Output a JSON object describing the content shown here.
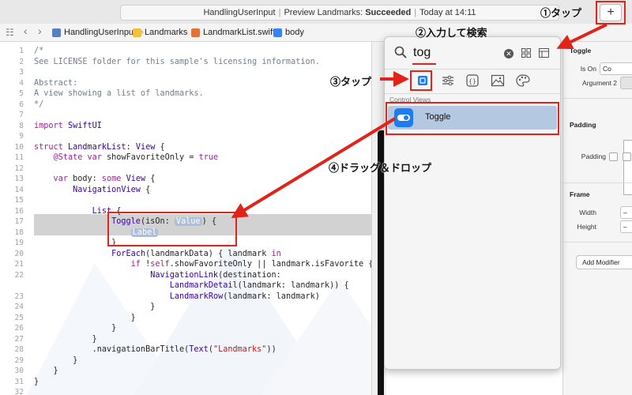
{
  "titlebar": {
    "project": "HandlingUserInput",
    "preview_label": "Preview Landmarks:",
    "status": "Succeeded",
    "time": "Today at 14:11",
    "add_button": "+"
  },
  "breadcrumb": [
    "HandlingUserInput",
    "Landmarks",
    "LandmarkList.swift",
    "body"
  ],
  "code": {
    "lines": [
      {
        "n": "1",
        "text": "/*"
      },
      {
        "n": "2",
        "text": "See LICENSE folder for this sample's licensing information."
      },
      {
        "n": "3",
        "text": ""
      },
      {
        "n": "4",
        "text": "Abstract:"
      },
      {
        "n": "5",
        "text": "A view showing a list of landmarks."
      },
      {
        "n": "6",
        "text": "*/"
      },
      {
        "n": "7",
        "text": ""
      },
      {
        "n": "8",
        "text": "import SwiftUI"
      },
      {
        "n": "9",
        "text": ""
      },
      {
        "n": "10",
        "text": "struct LandmarkList: View {"
      },
      {
        "n": "11",
        "text": "    @State var showFavoriteOnly = true"
      },
      {
        "n": "12",
        "text": ""
      },
      {
        "n": "13",
        "text": "    var body: some View {"
      },
      {
        "n": "14",
        "text": "        NavigationView {"
      },
      {
        "n": "15",
        "text": ""
      },
      {
        "n": "16",
        "text": "            List {"
      },
      {
        "n": "17",
        "text": "                Toggle(isOn: Value) {"
      },
      {
        "n": "18",
        "text": "                    Label"
      },
      {
        "n": "19",
        "text": "                }"
      },
      {
        "n": "20",
        "text": "                ForEach(landmarkData) { landmark in"
      },
      {
        "n": "21",
        "text": "                    if !self.showFavoriteOnly || landmark.isFavorite {"
      },
      {
        "n": "22",
        "text": "                        NavigationLink(destination:"
      },
      {
        "n": "",
        "text": "                            LandmarkDetail(landmark: landmark)) {"
      },
      {
        "n": "23",
        "text": "                            LandmarkRow(landmark: landmark)"
      },
      {
        "n": "24",
        "text": "                        }"
      },
      {
        "n": "25",
        "text": "                    }"
      },
      {
        "n": "26",
        "text": "                }"
      },
      {
        "n": "27",
        "text": "            }"
      },
      {
        "n": "28",
        "text": "            .navigationBarTitle(Text(\"Landmarks\"))"
      },
      {
        "n": "29",
        "text": "        }"
      },
      {
        "n": "30",
        "text": "    }"
      },
      {
        "n": "31",
        "text": "}"
      },
      {
        "n": "32",
        "text": ""
      }
    ]
  },
  "library": {
    "search_value": "tog",
    "clear_icon": "clear-icon",
    "section": "Control Views",
    "item": "Toggle",
    "tabs": [
      "views-tab",
      "modifiers-tab",
      "snippets-tab",
      "media-tab",
      "colors-tab"
    ]
  },
  "inspector": {
    "toggle_header": "Toggle",
    "is_on_label": "Is On",
    "is_on_value": "Co",
    "argument2_label": "Argument 2",
    "padding_header": "Padding",
    "padding_label": "Padding",
    "frame_header": "Frame",
    "width_label": "Width",
    "width_value": "–",
    "height_label": "Height",
    "height_value": "–",
    "add_modifier": "Add Modifier"
  },
  "annotations": {
    "step1": "①タップ",
    "step2": "②入力して検索",
    "step3": "③タップ",
    "step4": "④ドラッグ＆ドロップ"
  },
  "colors": {
    "annotation_red": "#e2231a",
    "selection_blue": "#b5c8e2",
    "toggle_blue": "#1c7cf4",
    "keyword_purple": "#9b2393",
    "string_red": "#c41a16"
  }
}
